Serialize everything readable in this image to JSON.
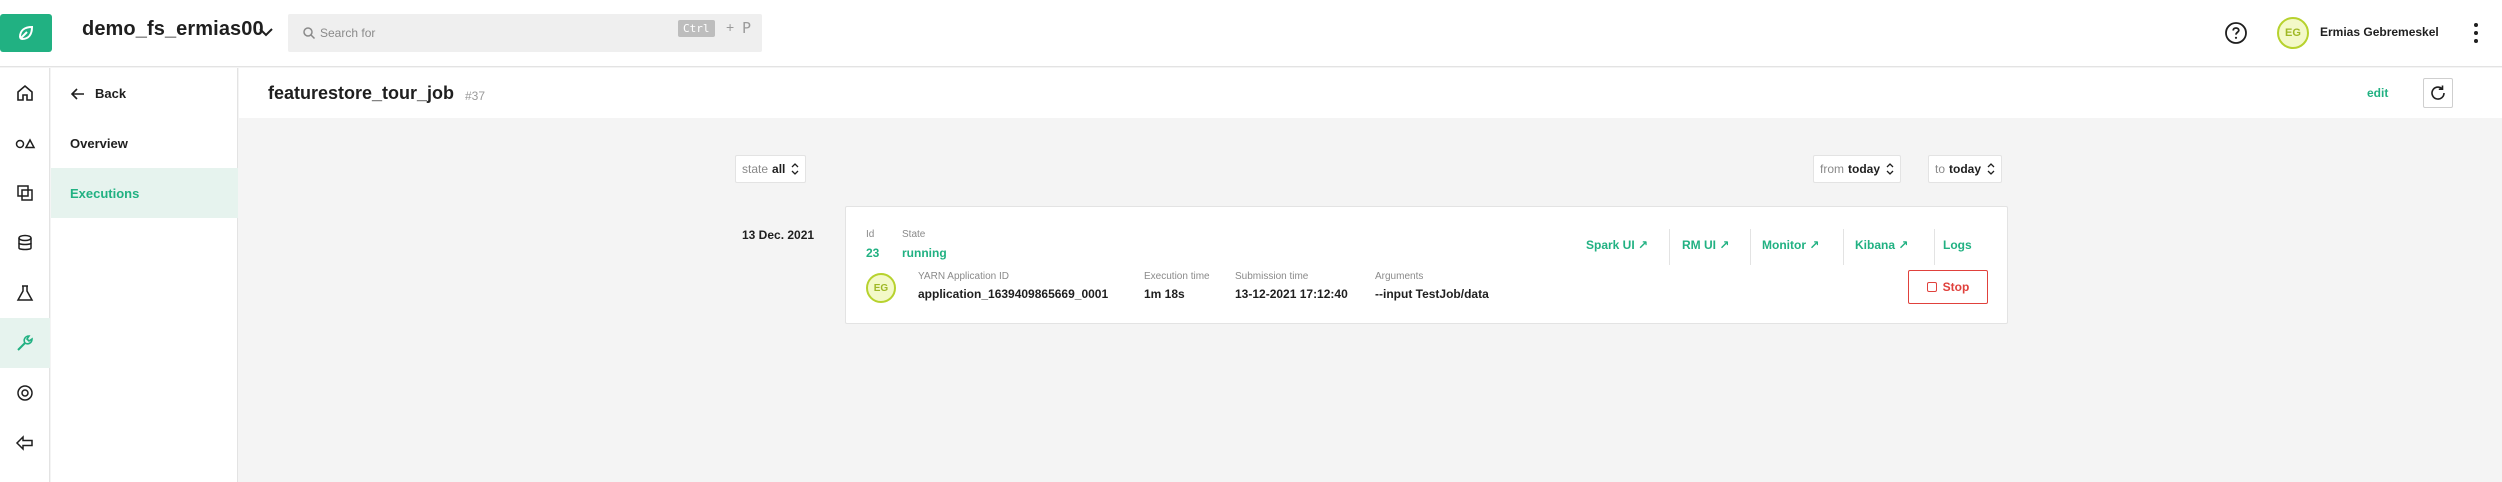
{
  "topbar": {
    "project_name": "demo_fs_ermias00",
    "search_placeholder": "Search for",
    "shortcut_modifier": "Ctrl",
    "shortcut_plus": "+",
    "shortcut_key": "P",
    "user_initials": "EG",
    "user_name": "Ermias Gebremeskel"
  },
  "rail": {
    "items": [
      {
        "icon": "home-icon"
      },
      {
        "icon": "features-icon"
      },
      {
        "icon": "training-datasets-icon"
      },
      {
        "icon": "database-icon"
      },
      {
        "icon": "experiments-icon"
      },
      {
        "icon": "jobs-icon",
        "active": true
      },
      {
        "icon": "settings-icon"
      },
      {
        "icon": "exit-icon"
      }
    ]
  },
  "subnav": {
    "back_label": "Back",
    "items": [
      {
        "label": "Overview"
      },
      {
        "label": "Executions",
        "active": true
      }
    ]
  },
  "page": {
    "title": "featurestore_tour_job",
    "id": "#37",
    "edit_label": "edit"
  },
  "filters": {
    "state": {
      "label": "state",
      "value": "all"
    },
    "from": {
      "label": "from",
      "value": "today"
    },
    "to": {
      "label": "to",
      "value": "today"
    }
  },
  "executions": [
    {
      "date": "13 Dec. 2021",
      "id_label": "Id",
      "id": "23",
      "state_label": "State",
      "state": "running",
      "user_initials": "EG",
      "yarn_label": "YARN Application ID",
      "yarn_id": "application_1639409865669_0001",
      "exec_time_label": "Execution time",
      "exec_time": "1m 18s",
      "submission_label": "Submission time",
      "submission_time": "13-12-2021 17:12:40",
      "arguments_label": "Arguments",
      "arguments": "--input TestJob/data",
      "links": {
        "spark_ui": "Spark UI ↗",
        "rm_ui": "RM UI ↗",
        "monitor": "Monitor ↗",
        "kibana": "Kibana ↗",
        "logs": "Logs"
      },
      "stop_label": "Stop"
    }
  ],
  "colors": {
    "accent": "#21b182",
    "danger": "#e0413c",
    "avatar_border": "#b7d22e"
  }
}
